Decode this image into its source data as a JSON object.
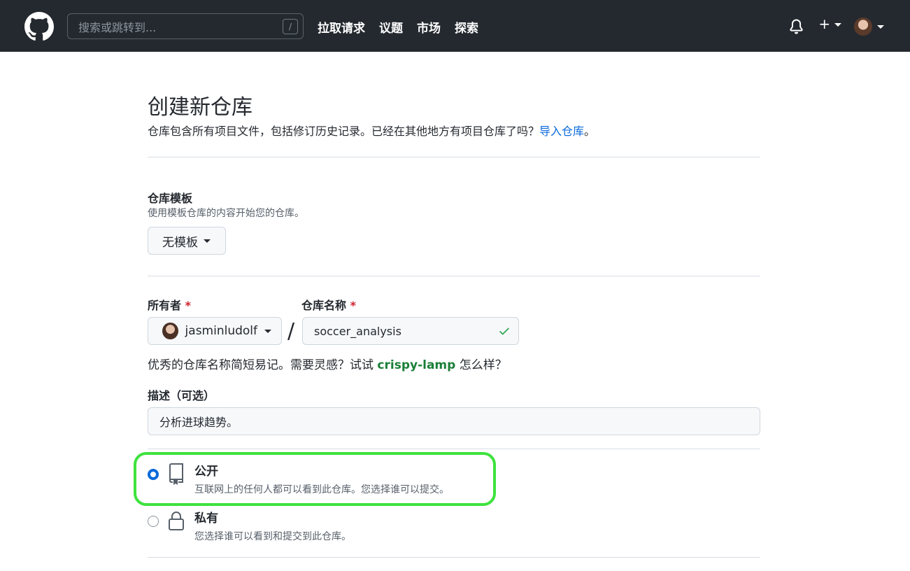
{
  "header": {
    "search_placeholder": "搜索或跳转到...",
    "search_shortcut": "/",
    "nav": [
      "拉取请求",
      "议题",
      "市场",
      "探索"
    ]
  },
  "page": {
    "title": "创建新仓库",
    "subtitle_text": "仓库包含所有项目文件，包括修订历史记录。已经在其他地方有项目仓库了吗？",
    "import_link": "导入仓库",
    "subtitle_end": "。"
  },
  "template": {
    "label": "仓库模板",
    "note": "使用模板仓库的内容开始您的仓库。",
    "value": "无模板"
  },
  "owner": {
    "label": "所有者",
    "required": "*",
    "value": "jasminludolf"
  },
  "separator": "/",
  "repo_name": {
    "label": "仓库名称",
    "required": "*",
    "value": "soccer_analysis"
  },
  "name_hint": {
    "prefix": "优秀的仓库名称简短易记。需要灵感？试试 ",
    "suggestion": "crispy-lamp",
    "suffix": " 怎么样？"
  },
  "description": {
    "label": "描述（可选）",
    "value": "分析进球趋势。"
  },
  "visibility": {
    "public": {
      "title": "公开",
      "desc": "互联网上的任何人都可以看到此仓库。您选择谁可以提交。",
      "selected": true
    },
    "private": {
      "title": "私有",
      "desc": "您选择谁可以看到和提交到此仓库。",
      "selected": false
    }
  },
  "colors": {
    "header_bg": "#24292f",
    "link": "#0969da",
    "suggestion": "#1a7f37",
    "highlight": "#3ee23e",
    "required": "#cf222e"
  }
}
